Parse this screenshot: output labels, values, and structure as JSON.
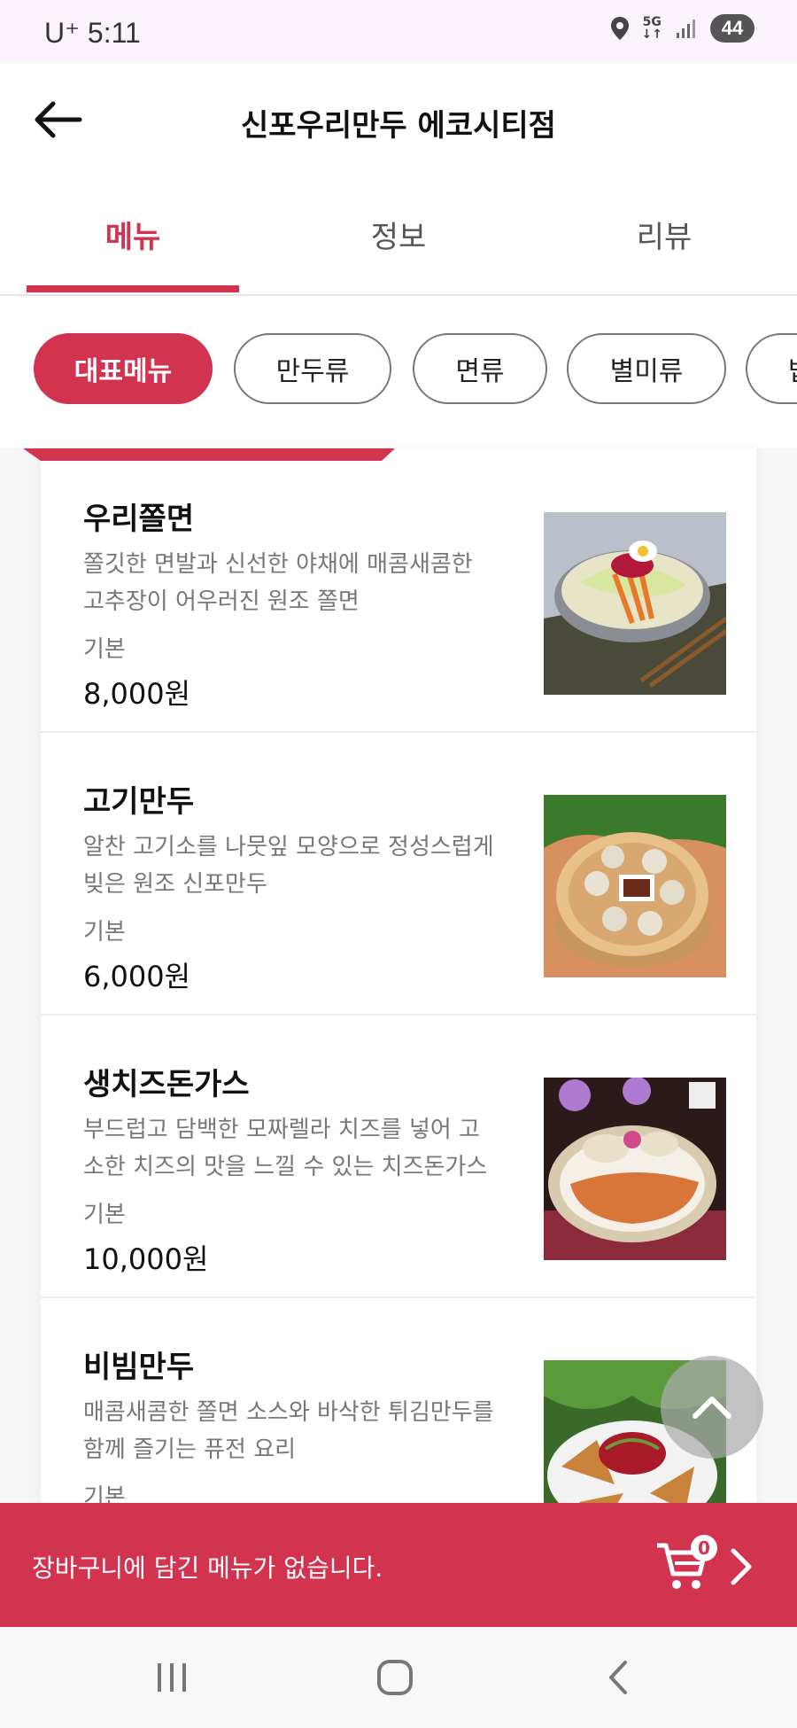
{
  "status": {
    "carrier": "U⁺ 5:11",
    "net": "5G",
    "battery": "44"
  },
  "header": {
    "title": "신포우리만두 에코시티점"
  },
  "tabs": [
    {
      "label": "메뉴"
    },
    {
      "label": "정보"
    },
    {
      "label": "리뷰"
    }
  ],
  "categories": [
    "대표메뉴",
    "만두류",
    "면류",
    "별미류",
    "밥"
  ],
  "menu": [
    {
      "name": "우리쫄면",
      "desc": "쫄깃한 면발과 신선한 야채에 매콤새콤한 고추장이 어우러진 원조 쫄면",
      "option": "기본",
      "price": "8,000원"
    },
    {
      "name": "고기만두",
      "desc": "알찬 고기소를 나뭇잎 모양으로 정성스럽게 빚은 원조 신포만두",
      "option": "기본",
      "price": "6,000원"
    },
    {
      "name": "생치즈돈가스",
      "desc": "부드럽고 담백한 모짜렐라 치즈를 넣어 고소한 치즈의 맛을 느낄 수 있는 치즈돈가스",
      "option": "기본",
      "price": "10,000원"
    },
    {
      "name": "비빔만두",
      "desc": "매콤새콤한 쫄면 소스와 바삭한 튀김만두를 함께 즐기는 퓨전 요리",
      "option": "기본",
      "price": ""
    }
  ],
  "cart": {
    "message": "장바구니에 담긴 메뉴가 없습니다.",
    "count": "0"
  },
  "colors": {
    "accent": "#d2334f",
    "statusbar": "#fbf3fb"
  }
}
